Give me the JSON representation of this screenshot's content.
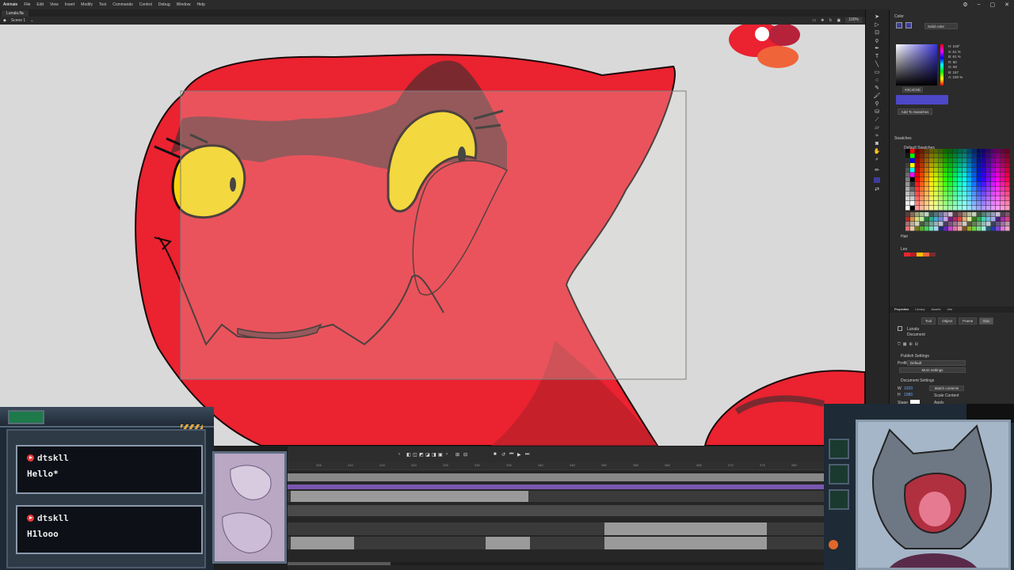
{
  "menubar": {
    "app": "Animate",
    "items": [
      "File",
      "Edit",
      "View",
      "Insert",
      "Modify",
      "Text",
      "Commands",
      "Control",
      "Debug",
      "Window",
      "Help"
    ]
  },
  "doc": {
    "tab": "Lunala.fla",
    "scene": "Scene 1",
    "zoom": "100%"
  },
  "color_panel": {
    "title": "Color",
    "fill_type": "Solid color",
    "hex": "#3C3C9D",
    "add_swatch_label": "Add To Swatches",
    "hsb": [
      "H: 240°",
      "S: 61 %",
      "B: 61 %"
    ],
    "rgb": [
      "R: 60",
      "G: 60",
      "B: 157"
    ],
    "alpha": "A: 100 %"
  },
  "swatches_panel": {
    "title": "Swatches",
    "default_label": "Default Swatches",
    "group1": "Hair",
    "group2": "Leo"
  },
  "properties_panel": {
    "tabs": [
      "Properties",
      "Library",
      "Assets",
      "Info"
    ],
    "subtabs": [
      "Tool",
      "Object",
      "Frame",
      "Doc"
    ],
    "doc_name": "Lunala",
    "doc_type": "Document",
    "publish_settings": "Publish Settings",
    "profile_label": "Profile",
    "profile_value": "Default",
    "more_settings": "More settings",
    "document_settings": "Document Settings",
    "w_label": "W",
    "w_value": "1920",
    "h_label": "H",
    "h_value": "1080",
    "match_contents": "Match contents",
    "scale_content": "Scale Content",
    "stage_label": "Stage",
    "apply_label": "Apply"
  },
  "timeline": {
    "ruler_labels": [
      "205",
      "210",
      "215",
      "220",
      "225",
      "230",
      "235",
      "240",
      "245",
      "250",
      "255",
      "260",
      "265",
      "270",
      "275",
      "280"
    ]
  },
  "chat": [
    {
      "user": "dtskll",
      "message": "Hello*"
    },
    {
      "user": "dtskll",
      "message": "H1looo"
    }
  ],
  "colors": {
    "character_red": "#eb2230",
    "shadow": "#7a2a2f",
    "eye_yellow": "#f7d30a",
    "stage_bg": "#d9d9d9",
    "overlay_frame": "#8a9aab"
  }
}
